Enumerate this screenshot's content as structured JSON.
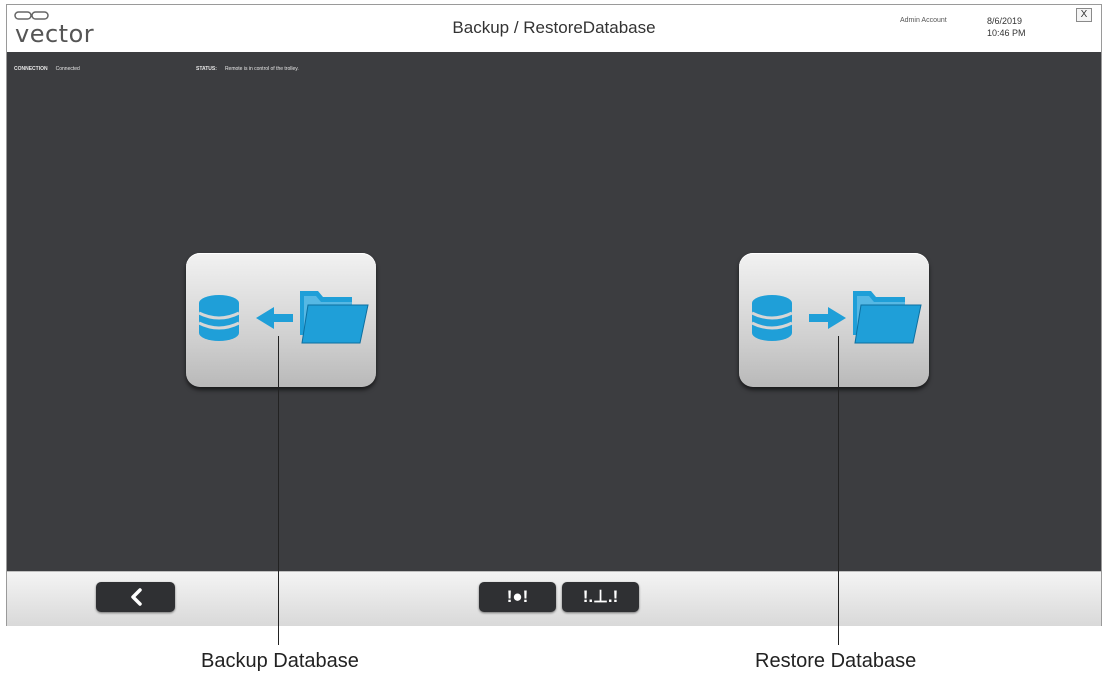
{
  "header": {
    "logo_text": "vector",
    "title": "Backup / RestoreDatabase",
    "account": "Admin Account",
    "date": "8/6/2019",
    "time": "10:46 PM",
    "close_label": "X"
  },
  "status": {
    "connection_label": "CONNECTION",
    "connection_value": "Connected",
    "status_label": "STATUS:",
    "status_value": "Remote is in control of the trolley."
  },
  "tiles": {
    "backup": {
      "icon": "database-backup-icon"
    },
    "restore": {
      "icon": "database-restore-icon"
    }
  },
  "footer": {
    "back_icon": "chevron-left-icon",
    "stop_label": "!●!",
    "download_label": "!.⊥.!"
  },
  "callouts": {
    "backup": "Backup Database",
    "restore": "Restore Database"
  },
  "colors": {
    "background": "#3c3d40",
    "icon_blue": "#1f9fd8",
    "button_dark": "#2f3033"
  }
}
